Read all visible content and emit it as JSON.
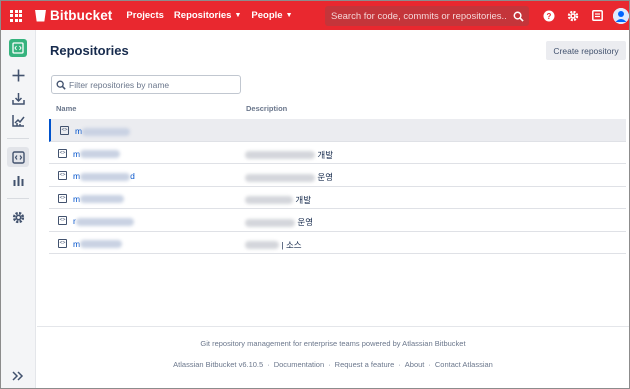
{
  "topbar": {
    "brand": "Bitbucket",
    "nav": [
      {
        "label": "Projects",
        "caret": false
      },
      {
        "label": "Repositories",
        "caret": true
      },
      {
        "label": "People",
        "caret": true
      }
    ],
    "search_placeholder": "Search for code, commits or repositories..."
  },
  "main": {
    "title": "Repositories",
    "create_button": "Create repository",
    "filter_placeholder": "Filter repositories by name",
    "columns": {
      "name": "Name",
      "description": "Description"
    },
    "rows": [
      {
        "name_prefix": "m",
        "name_suffix": "",
        "desc_suffix": "",
        "selected": true
      },
      {
        "name_prefix": "m",
        "name_suffix": "",
        "desc_suffix": "개발",
        "selected": false
      },
      {
        "name_prefix": "m",
        "name_suffix": "d",
        "desc_suffix": "운영",
        "selected": false
      },
      {
        "name_prefix": "m",
        "name_suffix": "",
        "desc_suffix": "개발",
        "selected": false
      },
      {
        "name_prefix": "r",
        "name_suffix": "",
        "desc_suffix": "운영",
        "selected": false
      },
      {
        "name_prefix": "m",
        "name_suffix": "",
        "desc_suffix": "| 소스",
        "selected": false
      }
    ]
  },
  "footer": {
    "tagline": "Git repository management for enterprise teams powered by Atlassian Bitbucket",
    "links": [
      "Atlassian Bitbucket v6.10.5",
      "Documentation",
      "Request a feature",
      "About",
      "Contact Atlassian"
    ],
    "separator": "·"
  },
  "colors": {
    "brand": "#e9282f",
    "link": "#0052cc",
    "text": "#172b4d"
  },
  "icons": {
    "sidebar": [
      "repository-icon",
      "plus-icon",
      "download-icon",
      "chart-line-icon",
      "code-icon",
      "bar-chart-icon",
      "gear-icon",
      "expand-icon"
    ],
    "topbar": [
      "apps-icon",
      "help-icon",
      "gear-icon",
      "inbox-icon",
      "avatar"
    ]
  }
}
